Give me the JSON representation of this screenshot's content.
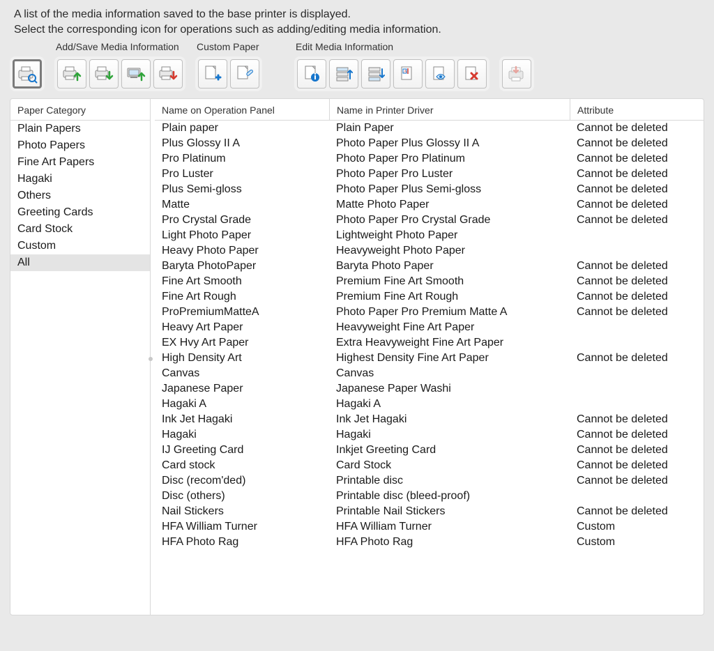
{
  "header": {
    "line1": "A list of the media information saved to the base printer is displayed.",
    "line2": "Select the corresponding icon for operations such as adding/editing media information."
  },
  "toolbar": {
    "group_labels": {
      "addsave": "Add/Save Media Information",
      "custom": "Custom Paper",
      "edit": "Edit Media Information"
    }
  },
  "sidebar": {
    "header": "Paper Category",
    "items": [
      {
        "label": "Plain Papers",
        "selected": false
      },
      {
        "label": "Photo Papers",
        "selected": false
      },
      {
        "label": "Fine Art Papers",
        "selected": false
      },
      {
        "label": "Hagaki",
        "selected": false
      },
      {
        "label": "Others",
        "selected": false
      },
      {
        "label": "Greeting Cards",
        "selected": false
      },
      {
        "label": "Card Stock",
        "selected": false
      },
      {
        "label": "Custom",
        "selected": false
      },
      {
        "label": "All",
        "selected": true
      }
    ]
  },
  "table": {
    "columns": {
      "op": "Name on Operation Panel",
      "drv": "Name in Printer Driver",
      "attr": "Attribute"
    },
    "rows": [
      {
        "op": "Plain paper",
        "drv": "Plain Paper",
        "attr": "Cannot be deleted"
      },
      {
        "op": "Plus Glossy II A",
        "drv": "Photo Paper Plus Glossy II A",
        "attr": "Cannot be deleted"
      },
      {
        "op": "Pro Platinum",
        "drv": "Photo Paper Pro Platinum",
        "attr": "Cannot be deleted"
      },
      {
        "op": "Pro Luster",
        "drv": "Photo Paper Pro Luster",
        "attr": "Cannot be deleted"
      },
      {
        "op": "Plus Semi-gloss",
        "drv": "Photo Paper Plus Semi-gloss",
        "attr": "Cannot be deleted"
      },
      {
        "op": "Matte",
        "drv": "Matte Photo Paper",
        "attr": "Cannot be deleted"
      },
      {
        "op": "Pro Crystal Grade",
        "drv": "Photo Paper Pro Crystal Grade",
        "attr": "Cannot be deleted"
      },
      {
        "op": "Light Photo Paper",
        "drv": "Lightweight Photo Paper",
        "attr": ""
      },
      {
        "op": "Heavy Photo Paper",
        "drv": "Heavyweight Photo Paper",
        "attr": ""
      },
      {
        "op": "Baryta PhotoPaper",
        "drv": "Baryta Photo Paper",
        "attr": "Cannot be deleted"
      },
      {
        "op": "Fine Art Smooth",
        "drv": "Premium Fine Art Smooth",
        "attr": "Cannot be deleted"
      },
      {
        "op": "Fine Art Rough",
        "drv": "Premium Fine Art Rough",
        "attr": "Cannot be deleted"
      },
      {
        "op": "ProPremiumMatteA",
        "drv": "Photo Paper Pro Premium Matte A",
        "attr": "Cannot be deleted"
      },
      {
        "op": "Heavy Art Paper",
        "drv": "Heavyweight Fine Art Paper",
        "attr": ""
      },
      {
        "op": "EX Hvy Art Paper",
        "drv": "Extra Heavyweight Fine Art Paper",
        "attr": ""
      },
      {
        "op": "High Density Art",
        "drv": "Highest Density Fine Art Paper",
        "attr": "Cannot be deleted"
      },
      {
        "op": "Canvas",
        "drv": "Canvas",
        "attr": ""
      },
      {
        "op": "Japanese Paper",
        "drv": "Japanese Paper Washi",
        "attr": ""
      },
      {
        "op": "Hagaki A",
        "drv": "Hagaki A",
        "attr": ""
      },
      {
        "op": "Ink Jet Hagaki",
        "drv": "Ink Jet Hagaki",
        "attr": "Cannot be deleted"
      },
      {
        "op": "Hagaki",
        "drv": "Hagaki",
        "attr": "Cannot be deleted"
      },
      {
        "op": "IJ Greeting Card",
        "drv": "Inkjet Greeting Card",
        "attr": "Cannot be deleted"
      },
      {
        "op": "Card stock",
        "drv": "Card Stock",
        "attr": "Cannot be deleted"
      },
      {
        "op": "Disc (recom'ded)",
        "drv": "Printable disc",
        "attr": "Cannot be deleted"
      },
      {
        "op": "Disc (others)",
        "drv": "Printable disc (bleed-proof)",
        "attr": ""
      },
      {
        "op": "Nail Stickers",
        "drv": "Printable Nail Stickers",
        "attr": "Cannot be deleted"
      },
      {
        "op": "HFA William Turner",
        "drv": "HFA William Turner",
        "attr": "Custom"
      },
      {
        "op": "HFA Photo Rag",
        "drv": "HFA Photo Rag",
        "attr": "Custom"
      }
    ]
  }
}
